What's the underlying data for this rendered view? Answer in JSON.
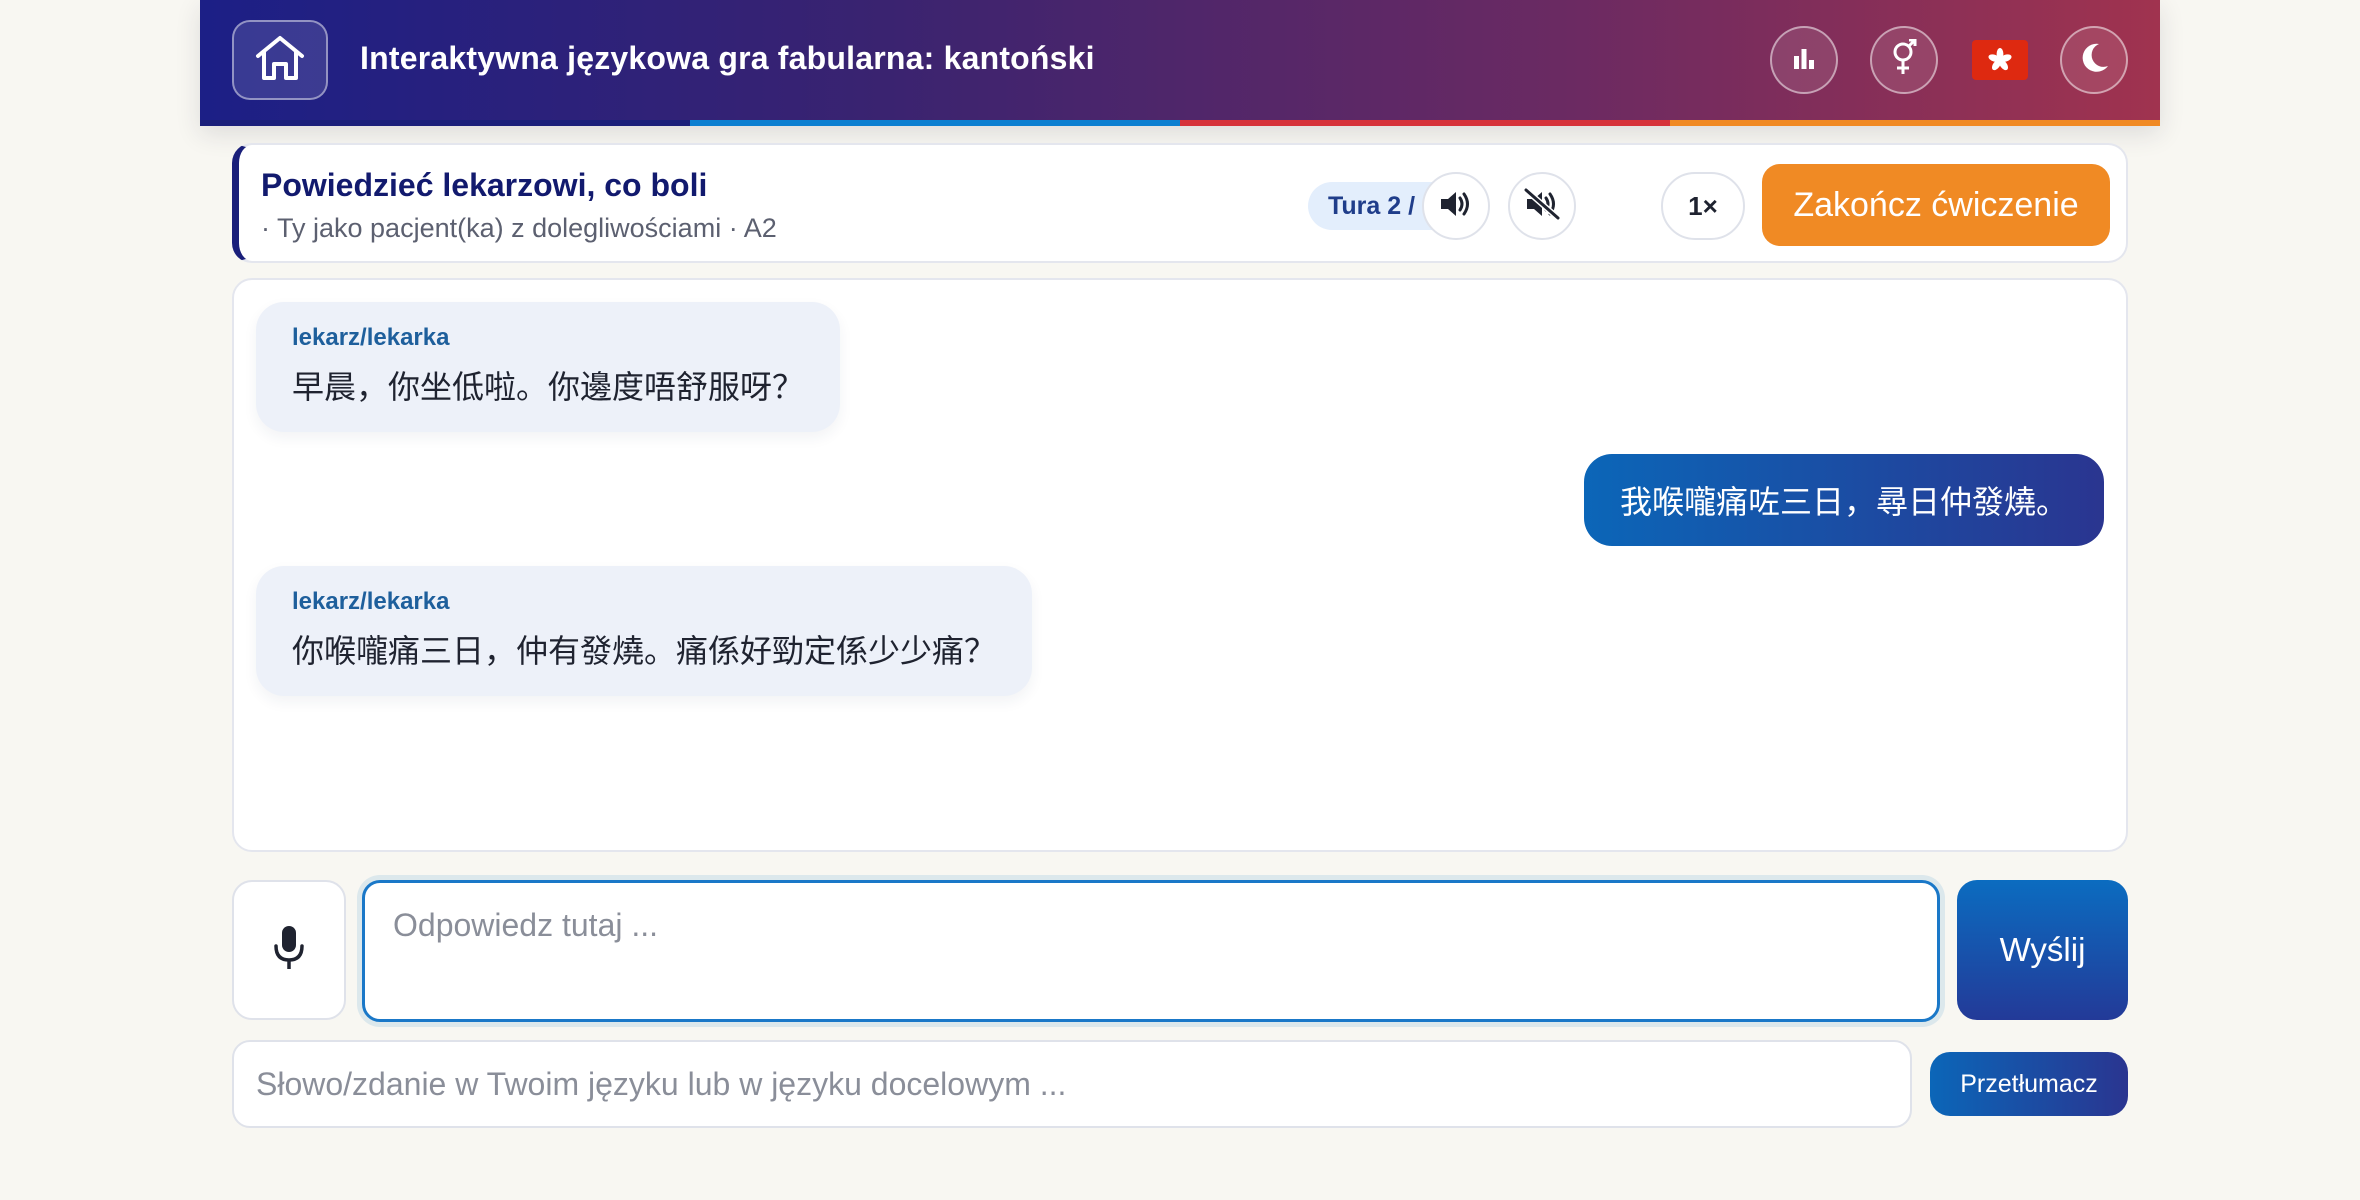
{
  "header": {
    "title": "Interaktywna językowa gra fabularna: kantoński",
    "icons": [
      "home-icon",
      "bar-chart-icon",
      "gender-icon",
      "hong-kong-flag-icon",
      "moon-icon"
    ],
    "stripe_colors": [
      "#1a1f7a",
      "#0b7fd1",
      "#d6323b",
      "#f08a24"
    ]
  },
  "scenario": {
    "title": "Powiedzieć lekarzowi, co boli",
    "subtitle": "· Ty jako pacjent(ka) z dolegliwościami · A2",
    "turn": "Tura 2 / 10",
    "speed": "1×",
    "end_button": "Zakończ ćwiczenie",
    "icons": [
      "speaker-icon",
      "speaker-off-icon"
    ]
  },
  "chat": {
    "messages": [
      {
        "role": "ai",
        "speaker": "lekarz/lekarka",
        "text": "早晨，你坐低啦。你邊度唔舒服呀？"
      },
      {
        "role": "user",
        "text": "我喉嚨痛咗三日，尋日仲發燒。"
      },
      {
        "role": "ai",
        "speaker": "lekarz/lekarka",
        "text": "你喉嚨痛三日，仲有發燒。痛係好勁定係少少痛？"
      }
    ]
  },
  "input": {
    "placeholder": "Odpowiedz tutaj ...",
    "value": "",
    "send_label": "Wyślij",
    "mic_icon": "microphone-icon"
  },
  "translator": {
    "placeholder": "Słowo/zdanie w Twoim języku lub w języku docelowym ...",
    "value": "",
    "button_label": "Przetłumacz"
  },
  "colors": {
    "accent_orange": "#f08a24",
    "accent_blue": "#0b66b8",
    "header_start": "#1c1f86",
    "header_end": "#a0334f"
  }
}
